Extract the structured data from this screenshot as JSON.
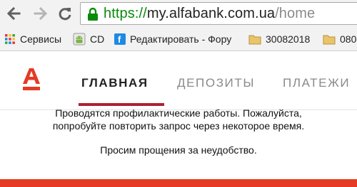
{
  "browser": {
    "url_scheme": "https://",
    "url_host": "my.alfabank.com.ua",
    "url_path": "/home",
    "secure_color": "#0a8a0a"
  },
  "bookmarks": [
    {
      "label": "Сервисы",
      "icon": "apps-grid-icon"
    },
    {
      "label": "CD",
      "icon": "android-icon"
    },
    {
      "label": "Редактировать - Фору",
      "icon": "site-favicon-icon"
    },
    {
      "label": "30082018",
      "icon": "folder-icon"
    },
    {
      "label": "080",
      "icon": "folder-icon"
    }
  ],
  "site": {
    "brand_color": "#e53a23",
    "logo_letter": "A",
    "nav": [
      {
        "label": "ГЛАВНАЯ",
        "active": true
      },
      {
        "label": "ДЕПОЗИТЫ",
        "active": false
      },
      {
        "label": "ПЛАТЕЖИ",
        "active": false
      }
    ]
  },
  "message": {
    "line1": "Проводятся профилактические работы. Пожалуйста,",
    "line2": "попробуйте повторить запрос через некоторое время.",
    "apology": "Просим прощения за неудобство."
  }
}
